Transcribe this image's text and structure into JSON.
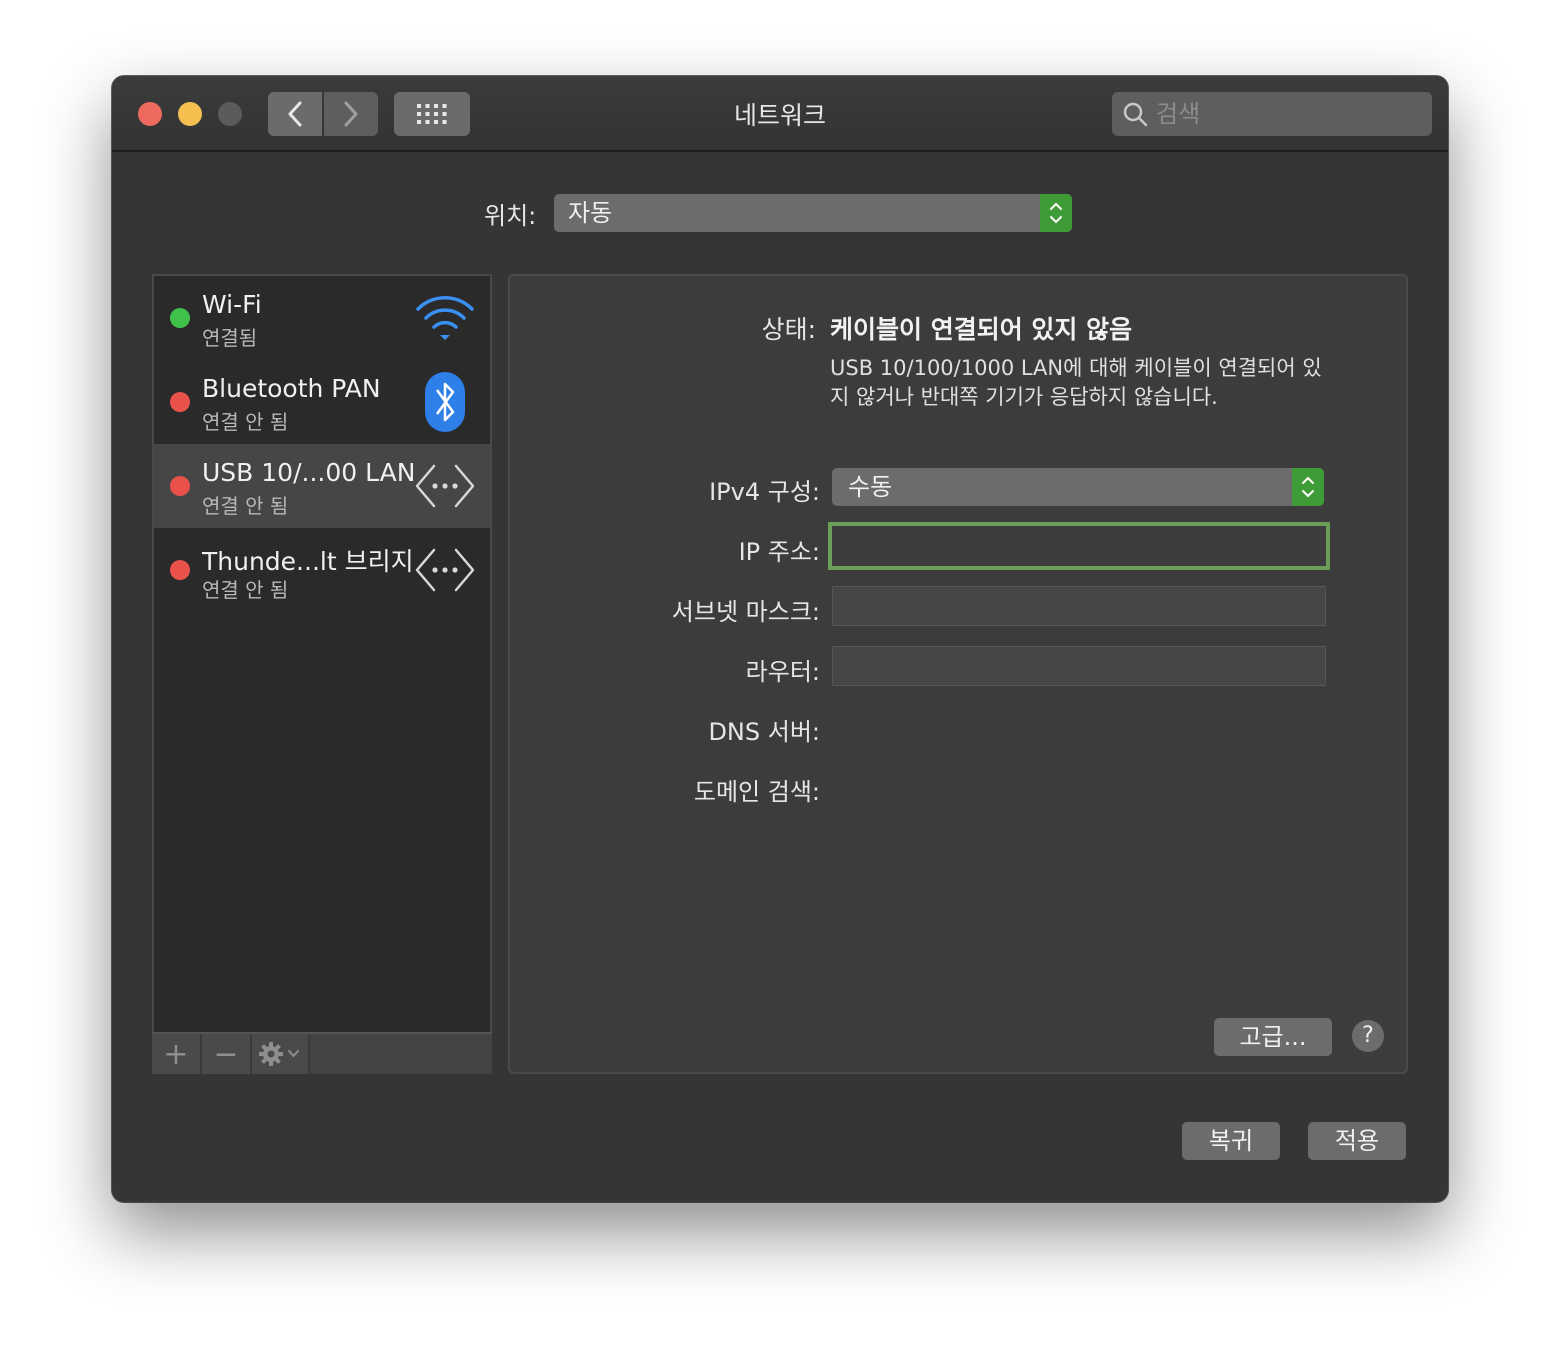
{
  "window": {
    "title": "네트워크",
    "search_placeholder": "검색"
  },
  "location": {
    "label": "위치:",
    "value": "자동"
  },
  "services": [
    {
      "name": "Wi-Fi",
      "status": "연결됨",
      "state_color": "#3fc24a",
      "icon": "wifi-icon"
    },
    {
      "name": "Bluetooth PAN",
      "status": "연결 안 됨",
      "state_color": "#e8524a",
      "icon": "bluetooth-icon"
    },
    {
      "name": "USB 10/...00 LAN",
      "status": "연결 안 됨",
      "state_color": "#e8524a",
      "icon": "ethernet-icon",
      "selected": true
    },
    {
      "name": "Thunde...lt 브리지",
      "status": "연결 안 됨",
      "state_color": "#e8524a",
      "icon": "ethernet-icon"
    }
  ],
  "sidebar_toolbar": {
    "add": "+",
    "remove": "−"
  },
  "detail": {
    "status_label": "상태:",
    "status_value": "케이블이 연결되어 있지 않음",
    "status_description": "USB 10/100/1000 LAN에 대해 케이블이 연결되어 있지 않거나 반대쪽 기기가 응답하지 않습니다.",
    "ipv4_label": "IPv4 구성:",
    "ipv4_value": "수동",
    "ip_label": "IP 주소:",
    "ip_value": "",
    "subnet_label": "서브넷 마스크:",
    "subnet_value": "",
    "router_label": "라우터:",
    "router_value": "",
    "dns_label": "DNS 서버:",
    "domain_label": "도메인 검색:",
    "advanced_button": "고급...",
    "help_button": "?"
  },
  "footer": {
    "revert_button": "복귀",
    "apply_button": "적용"
  },
  "colors": {
    "accent_green": "#3f9b35",
    "focus_ring": "#6a9e59",
    "connected": "#3fc24a",
    "disconnected": "#e8524a"
  }
}
